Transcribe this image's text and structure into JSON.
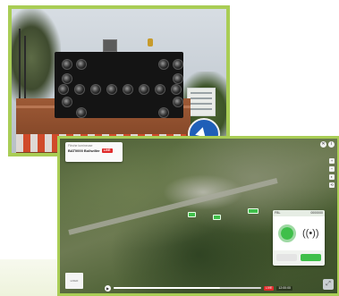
{
  "photo": {
    "sign_icon": "arrow-sign-icon"
  },
  "app": {
    "info_card": {
      "subtitle": "Flèche lumineuse",
      "title": "BAT0000 Bollwiller",
      "live_badge": "LIVE"
    },
    "camera_panel": {
      "header_left": "FBL",
      "header_right": "0000000",
      "status_icon": "signal-dot-icon",
      "wave_icon": "broadcast-icon",
      "button_left": "",
      "button_right": ""
    },
    "corner_buttons": [
      "✕",
      "i"
    ],
    "side_tools": [
      "+",
      "−",
      "◐",
      "⟲"
    ],
    "logo_text": "LOGO",
    "timeline": {
      "play_icon": "play-icon",
      "play_glyph": "▶",
      "progress": 0.72,
      "live_badge": "LIVE",
      "time": "12:00:00"
    },
    "expand_glyph": "⤢"
  },
  "colors": {
    "frame": "#a9cd55",
    "accent_green": "#3fbf4a",
    "live_red": "#e02b2b"
  }
}
